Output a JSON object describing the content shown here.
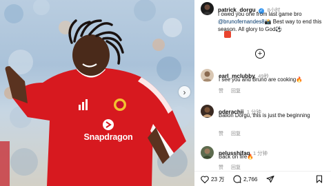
{
  "post": {
    "username": "patrick_dorgu",
    "time": "8小时",
    "caption_start": "I owed you one from last game bro ",
    "caption_mention": "@brunofernandes8",
    "caption_end": " Best way to end this season. All glory to God"
  },
  "media": {
    "sponsor_text": "Snapdragon"
  },
  "comments": [
    {
      "username": "earl_mclubby",
      "time": "49秒",
      "text": "I see you and Bruno are cooking",
      "like_label": "赞",
      "reply_label": "回复"
    },
    {
      "username": "oderachii",
      "time": "1 分钟",
      "text": "Ballon Dorgu, this is just the beginning",
      "like_label": "赞",
      "reply_label": "回复"
    },
    {
      "username": "nelusshifaq",
      "time": "1 分钟",
      "text": "Back on fire",
      "like_label": "赞",
      "reply_label": "回复"
    }
  ],
  "actions": {
    "likes": "23 万",
    "comments": "2,766"
  },
  "icons": {
    "verified": "verified-badge-icon",
    "add": "plus-circle-icon",
    "heart": "heart-icon",
    "comment": "comment-icon",
    "share": "share-icon",
    "save": "bookmark-icon",
    "next": "chevron-right-icon"
  },
  "colors": {
    "kit_red": "#d7191f",
    "verified_blue": "#3897f0",
    "mention_blue": "#00376b",
    "muted": "#8e8e8e"
  }
}
